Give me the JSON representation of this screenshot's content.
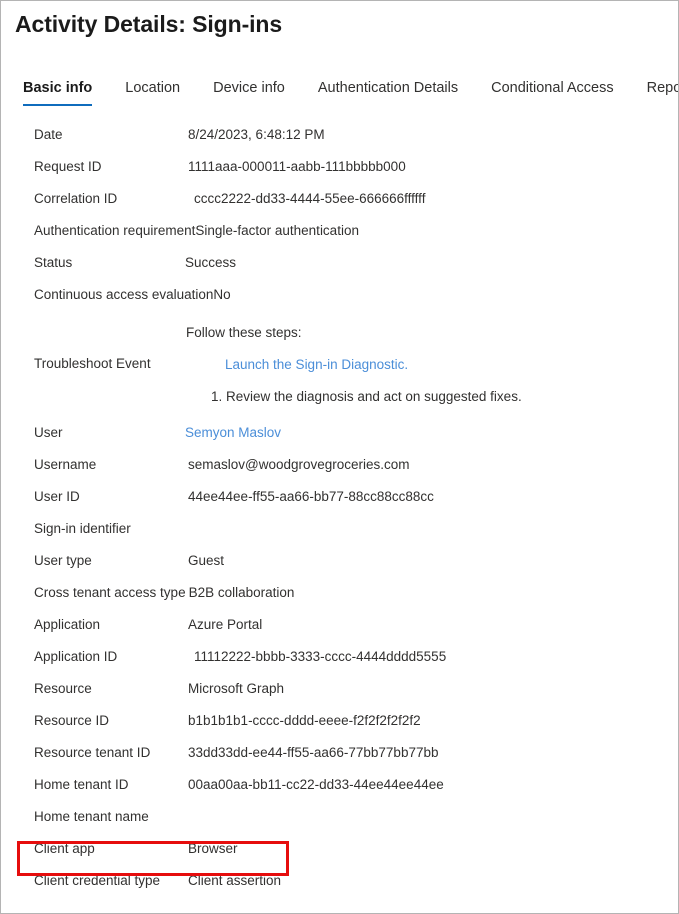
{
  "window": {
    "title": "Activity Details: Sign-ins"
  },
  "tabs": [
    {
      "label": "Basic info",
      "active": true
    },
    {
      "label": "Location",
      "active": false
    },
    {
      "label": "Device info",
      "active": false
    },
    {
      "label": "Authentication Details",
      "active": false
    },
    {
      "label": "Conditional Access",
      "active": false
    },
    {
      "label": "Report-only",
      "active": false
    }
  ],
  "details": {
    "date": {
      "label": "Date",
      "value": "8/24/2023, 6:48:12 PM"
    },
    "request_id": {
      "label": "Request ID",
      "value": "1111aaa-000011-aabb-111bbbbb000"
    },
    "correlation_id": {
      "label": "Correlation ID",
      "value": "cccc2222-dd33-4444-55ee-666666ffffff"
    },
    "auth_requirement": {
      "label": "Authentication requirement",
      "value": "Single-factor authentication"
    },
    "status": {
      "label": "Status",
      "value": "Success"
    },
    "cae": {
      "label": "Continuous access evaluation",
      "value": "No"
    },
    "troubleshoot": {
      "label": "Troubleshoot Event",
      "lead": "Follow these steps:",
      "link": "Launch the Sign-in Diagnostic.",
      "step1": "1. Review the diagnosis and act on suggested fixes."
    },
    "user": {
      "label": "User",
      "value": "Semyon Maslov"
    },
    "username": {
      "label": "Username",
      "value": "semaslov@woodgrovegroceries.com"
    },
    "user_id": {
      "label": "User ID",
      "value": "44ee44ee-ff55-aa66-bb77-88cc88cc88cc"
    },
    "signin_identifier": {
      "label": "Sign-in identifier",
      "value": ""
    },
    "user_type": {
      "label": "User type",
      "value": "Guest"
    },
    "cross_tenant_access_type": {
      "label": "Cross tenant access type",
      "value": "B2B collaboration"
    },
    "application": {
      "label": "Application",
      "value": "Azure Portal"
    },
    "application_id": {
      "label": "Application ID",
      "value": "11112222-bbbb-3333-cccc-4444dddd5555"
    },
    "resource": {
      "label": "Resource",
      "value": "Microsoft Graph"
    },
    "resource_id": {
      "label": "Resource ID",
      "value": "b1b1b1b1-cccc-dddd-eeee-f2f2f2f2f2f2"
    },
    "resource_tenant_id": {
      "label": "Resource tenant ID",
      "value": "33dd33dd-ee44-ff55-aa66-77bb77bb77bb"
    },
    "home_tenant_id": {
      "label": "Home tenant ID",
      "value": "00aa00aa-bb11-cc22-dd33-44ee44ee44ee"
    },
    "home_tenant_name": {
      "label": "Home tenant name",
      "value": ""
    },
    "client_app": {
      "label": "Client app",
      "value": "Browser"
    },
    "client_credential_type": {
      "label": "Client credential type",
      "value": "Client assertion"
    }
  },
  "annotation": {
    "highlight_color": "#e60d0d",
    "highlighted_row": "Client app"
  },
  "colors": {
    "accent": "#0f6cbd",
    "link": "#4b8ed8",
    "text": "#323130",
    "title": "#1b1b1b",
    "border": "#b4b4b4"
  }
}
